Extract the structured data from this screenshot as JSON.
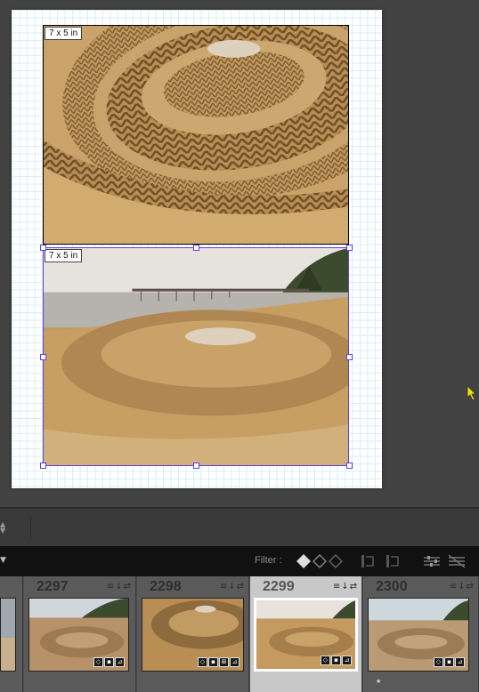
{
  "print_layout": {
    "cells": [
      {
        "size_label": "7 x 5 in"
      },
      {
        "size_label": "7 x 5 in"
      }
    ]
  },
  "toolbar": {
    "filter_label": "Filter :",
    "menu_icon": "dropdown-triangle-icon",
    "arrows_icon": "up-down-arrows-icon"
  },
  "filmstrip": {
    "items": [
      {
        "number": "2297"
      },
      {
        "number": "2298"
      },
      {
        "number": "2299",
        "selected": true
      },
      {
        "number": "2300"
      }
    ]
  },
  "colors": {
    "selection_border": "#5b3df0",
    "page_grid": "#d9eef4",
    "cursor": "#f5e100"
  }
}
